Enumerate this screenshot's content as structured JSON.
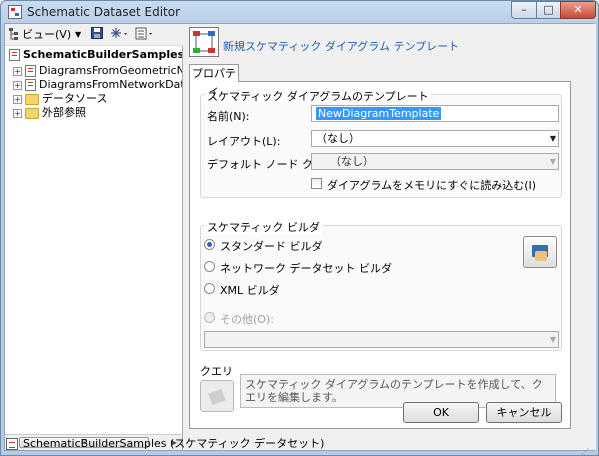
{
  "window": {
    "title": "Schematic Dataset Editor",
    "min_glyph": "–",
    "max_glyph": "□",
    "close_glyph": "✕"
  },
  "toolbar": {
    "view_label": "ビュー(V)",
    "view_arrow": "▼"
  },
  "tree": {
    "root": "SchematicBuilderSamples",
    "expander": "+",
    "items": [
      {
        "label": "DiagramsFromGeometricNetwor",
        "icon": "diagram-template-icon"
      },
      {
        "label": "DiagramsFromNetworkDataset",
        "icon": "diagram-template-icon"
      },
      {
        "label": "データソース",
        "icon": "folder-icon"
      },
      {
        "label": "外部参照",
        "icon": "folder-icon"
      }
    ]
  },
  "scroll": {
    "left": "◀",
    "right": "▶",
    "grip": "III"
  },
  "header": {
    "title": "新規スケマティック ダイアグラム テンプレート"
  },
  "tabs": [
    {
      "label": "プロパティ"
    }
  ],
  "template_group": {
    "title": "スケマティック ダイアグラムのテンプレート",
    "name_label": "名前(N):",
    "name_value": "NewDiagramTemplate",
    "layout_label": "レイアウト(L):",
    "layout_value": "（なし）",
    "node_class_label": "デフォルト ノード クラス(N):",
    "node_class_value": "（なし）",
    "load_checkbox_label": "ダイアグラムをメモリにすぐに読み込む(I)",
    "dropdown_glyph": "▼"
  },
  "builder_group": {
    "title": "スケマティック ビルダ",
    "options": [
      {
        "label": "スタンダード ビルダ",
        "selected": true
      },
      {
        "label": "ネットワーク データセット ビルダ",
        "selected": false
      },
      {
        "label": "XML ビルダ",
        "selected": false
      }
    ],
    "other_label": "その他(O):"
  },
  "query_group": {
    "title": "クエリ",
    "description": "スケマティック ダイアグラムのテンプレートを作成して、クエリを編集します。"
  },
  "buttons": {
    "ok": "OK",
    "cancel": "キャンセル"
  },
  "status": {
    "text": "SchematicBuilderSamples (スケマティック データセット)",
    "grip": "⋰"
  },
  "colors": {
    "accent": "#1a5fb4",
    "selection": "#3399ff",
    "titlebar": "#b3cbe6",
    "close": "#c64a36"
  }
}
